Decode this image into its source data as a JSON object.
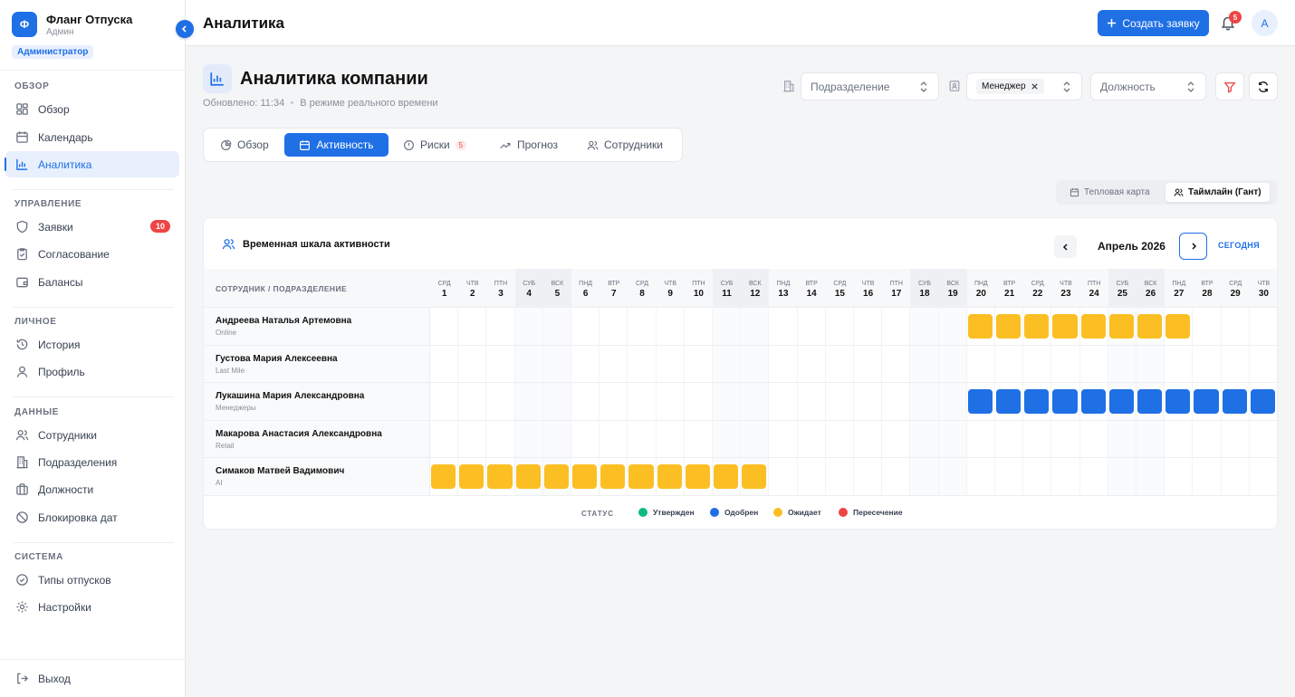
{
  "brand": {
    "logo_letter": "Ф",
    "name": "Фланг Отпуска",
    "subtitle": "Админ",
    "role_badge": "Администратор"
  },
  "sidebar": {
    "sections": [
      {
        "title": "ОБЗОР",
        "items": [
          {
            "label": "Обзор",
            "icon": "grid-icon"
          },
          {
            "label": "Календарь",
            "icon": "calendar-icon"
          },
          {
            "label": "Аналитика",
            "icon": "bar-chart-icon",
            "active": true
          }
        ]
      },
      {
        "title": "УПРАВЛЕНИЕ",
        "items": [
          {
            "label": "Заявки",
            "icon": "shield-icon",
            "badge": "10"
          },
          {
            "label": "Согласование",
            "icon": "clipboard-check-icon"
          },
          {
            "label": "Балансы",
            "icon": "wallet-icon"
          }
        ]
      },
      {
        "title": "ЛИЧНОЕ",
        "items": [
          {
            "label": "История",
            "icon": "history-icon"
          },
          {
            "label": "Профиль",
            "icon": "user-icon"
          }
        ]
      },
      {
        "title": "ДАННЫЕ",
        "items": [
          {
            "label": "Сотрудники",
            "icon": "users-icon"
          },
          {
            "label": "Подразделения",
            "icon": "building-icon"
          },
          {
            "label": "Должности",
            "icon": "briefcase-icon"
          },
          {
            "label": "Блокировка дат",
            "icon": "ban-icon"
          }
        ]
      },
      {
        "title": "СИСТЕМА",
        "items": [
          {
            "label": "Типы отпусков",
            "icon": "check-circle-icon"
          },
          {
            "label": "Настройки",
            "icon": "gear-icon"
          }
        ]
      }
    ],
    "logout_label": "Выход"
  },
  "header": {
    "title": "Аналитика",
    "create_button": "Создать заявку",
    "notifications_count": "5",
    "avatar_letter": "А"
  },
  "company": {
    "title": "Аналитика компании",
    "updated": "Обновлено: 11:34",
    "realtime": "В режиме реального времени"
  },
  "filters": {
    "department_placeholder": "Подразделение",
    "role_chip": "Менеджер",
    "position_placeholder": "Должность"
  },
  "tabs": [
    {
      "label": "Обзор",
      "icon": "pie-chart-icon"
    },
    {
      "label": "Активность",
      "icon": "calendar-icon",
      "active": true
    },
    {
      "label": "Риски",
      "icon": "alert-circle-icon",
      "badge": "5"
    },
    {
      "label": "Прогноз",
      "icon": "trending-up-icon"
    },
    {
      "label": "Сотрудники",
      "icon": "users-icon"
    }
  ],
  "view_switch": {
    "heatmap": "Тепловая карта",
    "timeline": "Таймлайн (Гант)"
  },
  "timeline": {
    "title": "Временная шкала активности",
    "month": "Апрель 2026",
    "today_label": "СЕГОДНЯ",
    "column_header": "СОТРУДНИК / ПОДРАЗДЕЛЕНИЕ",
    "days": [
      {
        "w": "СРД",
        "d": "1"
      },
      {
        "w": "ЧТВ",
        "d": "2"
      },
      {
        "w": "ПТН",
        "d": "3"
      },
      {
        "w": "СУБ",
        "d": "4"
      },
      {
        "w": "ВСК",
        "d": "5"
      },
      {
        "w": "ПНД",
        "d": "6"
      },
      {
        "w": "ВТР",
        "d": "7"
      },
      {
        "w": "СРД",
        "d": "8"
      },
      {
        "w": "ЧТВ",
        "d": "9"
      },
      {
        "w": "ПТН",
        "d": "10"
      },
      {
        "w": "СУБ",
        "d": "11"
      },
      {
        "w": "ВСК",
        "d": "12"
      },
      {
        "w": "ПНД",
        "d": "13"
      },
      {
        "w": "ВТР",
        "d": "14"
      },
      {
        "w": "СРД",
        "d": "15"
      },
      {
        "w": "ЧТВ",
        "d": "16"
      },
      {
        "w": "ПТН",
        "d": "17"
      },
      {
        "w": "СУБ",
        "d": "18"
      },
      {
        "w": "ВСК",
        "d": "19"
      },
      {
        "w": "ПНД",
        "d": "20"
      },
      {
        "w": "ВТР",
        "d": "21"
      },
      {
        "w": "СРД",
        "d": "22"
      },
      {
        "w": "ЧТВ",
        "d": "23"
      },
      {
        "w": "ПТН",
        "d": "24"
      },
      {
        "w": "СУБ",
        "d": "25"
      },
      {
        "w": "ВСК",
        "d": "26"
      },
      {
        "w": "ПНД",
        "d": "27"
      },
      {
        "w": "ВТР",
        "d": "28"
      },
      {
        "w": "СРД",
        "d": "29"
      },
      {
        "w": "ЧТВ",
        "d": "30"
      }
    ],
    "employees": [
      {
        "name": "Андреева Наталья Артемовна",
        "dept": "Online",
        "status": "pending",
        "from": 20,
        "to": 27
      },
      {
        "name": "Густова Мария Алексеевна",
        "dept": "Last Mile",
        "status": null,
        "from": null,
        "to": null
      },
      {
        "name": "Лукашина Мария Александровна",
        "dept": "Менеджеры",
        "status": "approved",
        "from": 20,
        "to": 30
      },
      {
        "name": "Макарова Анастасия Александровна",
        "dept": "Retail",
        "status": null,
        "from": null,
        "to": null
      },
      {
        "name": "Симаков Матвей Вадимович",
        "dept": "AI",
        "status": "pending",
        "from": 1,
        "to": 12
      }
    ],
    "legend": {
      "title": "СТАТУС",
      "items": [
        {
          "key": "confirmed",
          "label": "Утвержден",
          "color": "#10b981"
        },
        {
          "key": "approved",
          "label": "Одобрен",
          "color": "#1f6fe5"
        },
        {
          "key": "pending",
          "label": "Ожидает",
          "color": "#fbbf24"
        },
        {
          "key": "overlap",
          "label": "Пересечение",
          "color": "#ef4444"
        }
      ]
    }
  }
}
